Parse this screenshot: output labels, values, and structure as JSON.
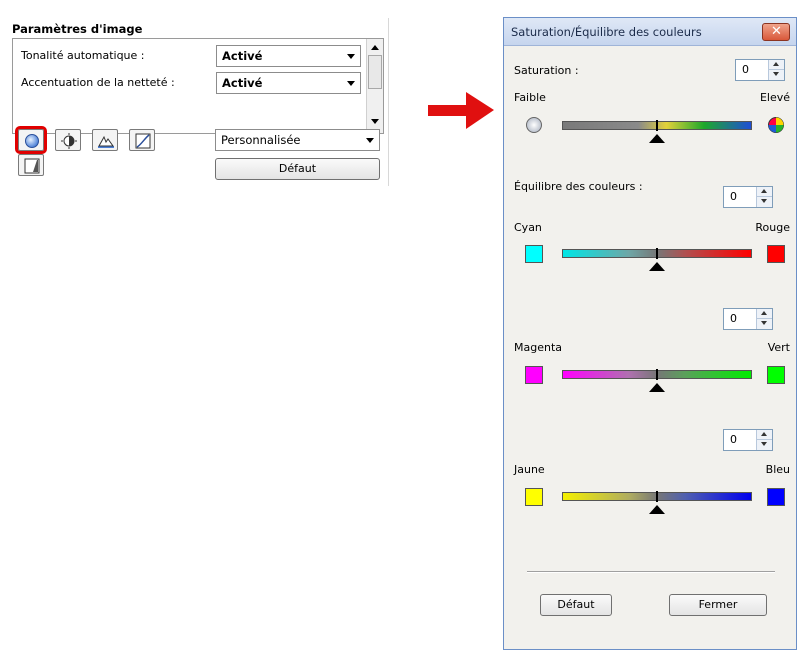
{
  "left_panel": {
    "title": "Paramètres d'image",
    "settings": [
      {
        "label": "Tonalité automatique :",
        "value": "Activé"
      },
      {
        "label": "Accentuation de la netteté :",
        "value": "Activé"
      }
    ],
    "preset_value": "Personnalisée",
    "default_button": "Défaut",
    "tool_icons": [
      "saturation-icon",
      "brightness-contrast-icon",
      "histogram-icon",
      "tone-curve-icon",
      "threshold-icon"
    ]
  },
  "dialog": {
    "title": "Saturation/Équilibre des couleurs",
    "close_glyph": "✕",
    "saturation": {
      "label": "Saturation :",
      "value": "0",
      "low_label": "Faible",
      "high_label": "Elevé"
    },
    "balance_title": "Équilibre des couleurs :",
    "balances": [
      {
        "value": "0",
        "left_label": "Cyan",
        "right_label": "Rouge",
        "left_color": "#00ffff",
        "right_color": "#ff0000"
      },
      {
        "value": "0",
        "left_label": "Magenta",
        "right_label": "Vert",
        "left_color": "#ff00ff",
        "right_color": "#00ff00"
      },
      {
        "value": "0",
        "left_label": "Jaune",
        "right_label": "Bleu",
        "left_color": "#ffff00",
        "right_color": "#0000ff"
      }
    ],
    "default_button": "Défaut",
    "close_button": "Fermer"
  },
  "colors": {
    "highlight": "#e00000",
    "arrow": "#e01010"
  }
}
